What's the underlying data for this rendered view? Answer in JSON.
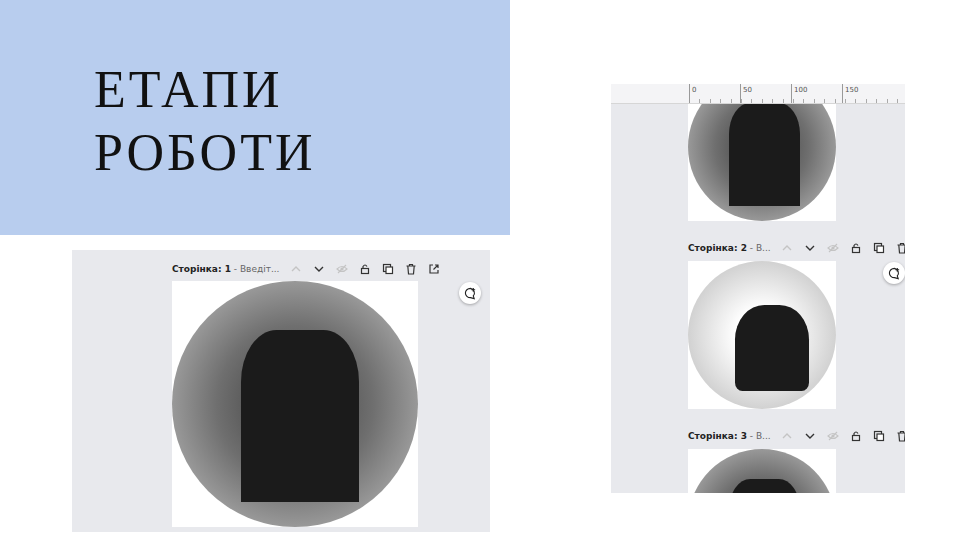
{
  "slide": {
    "title": [
      "ЕТАПИ",
      "РОБОТИ"
    ]
  },
  "left_editor": {
    "pages": [
      {
        "toolbar": {
          "label": "Сторінка: 1",
          "title": "- Введіт..."
        },
        "kind": "dark"
      }
    ]
  },
  "right_editor": {
    "ruler": [
      "0",
      "50",
      "100",
      "150"
    ],
    "pages": [
      {
        "toolbar": null,
        "kind": "dark"
      },
      {
        "toolbar": {
          "label": "Сторінка: 2",
          "title": "- В..."
        },
        "kind": "light"
      },
      {
        "toolbar": {
          "label": "Сторінка: 3",
          "title": "- В..."
        },
        "kind": "dark"
      }
    ]
  }
}
